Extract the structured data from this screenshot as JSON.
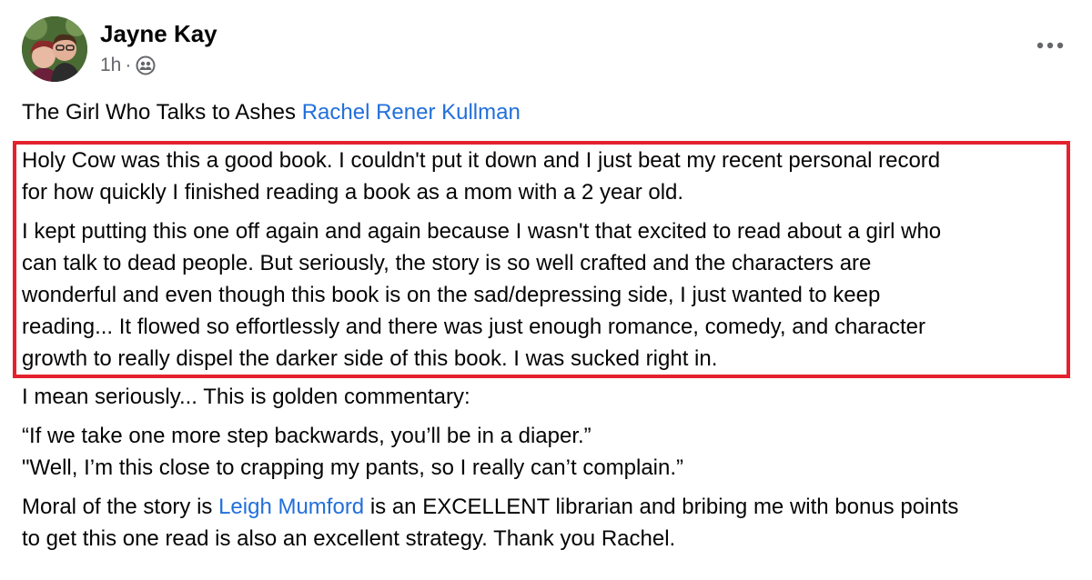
{
  "post": {
    "author": "Jayne Kay",
    "time": "1h",
    "separator": "·",
    "audience_icon": "friends-icon",
    "more_icon": "more-horizontal-icon",
    "title_text": "The Girl Who Talks to Ashes ",
    "title_link": "Rachel Rener Kullman",
    "highlight_color": "#e4222e",
    "link_color": "#216fdb",
    "highlight_lines": [
      "Holy Cow was this a good book. I couldn't put it down and I just beat my recent personal record",
      "for how quickly I finished reading a book as a mom with a 2 year old.",
      "I kept putting this one off again and again because I wasn't that excited to read about a girl who",
      "can talk to dead people. But seriously, the story is so well crafted and the characters are",
      "wonderful and even though this book is on the sad/depressing side, I just wanted to keep",
      "reading... It flowed so effortlessly and there was just enough romance, comedy, and character",
      "growth to really dispel the darker side of this book. I was sucked right in."
    ],
    "commentary_line": "I mean seriously... This is golden commentary:",
    "quote_1": "“If we take one more step backwards, you’ll be in a diaper.”",
    "quote_2": "\"Well, I’m this close to crapping my pants, so I really can’t complain.”",
    "moral_prefix": "Moral of the story is ",
    "moral_link": "Leigh Mumford",
    "moral_suffix": " is an EXCELLENT librarian and bribing me with bonus points",
    "moral_line_2": "to get this one read is also an excellent strategy. Thank you Rachel."
  }
}
